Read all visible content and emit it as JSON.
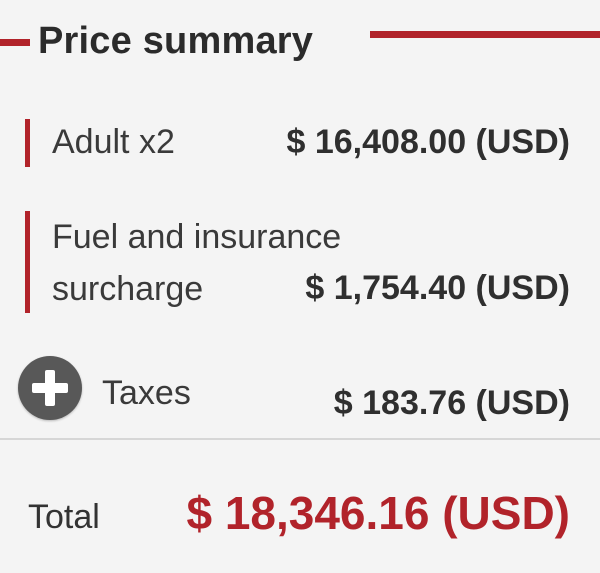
{
  "header": {
    "title": "Price summary"
  },
  "items": [
    {
      "label": "Adult x2",
      "amount": "$ 16,408.00 (USD)"
    },
    {
      "label": "Fuel and insurance surcharge",
      "amount": "$ 1,754.40 (USD)"
    },
    {
      "label": "Taxes",
      "amount": "$ 183.76 (USD)",
      "toggle_icon": "plus-circle-icon"
    }
  ],
  "total": {
    "label": "Total",
    "amount": "$ 18,346.16 (USD)"
  },
  "colors": {
    "accent": "#b1232a",
    "toggle": "#585858",
    "background": "#f4f4f4"
  }
}
